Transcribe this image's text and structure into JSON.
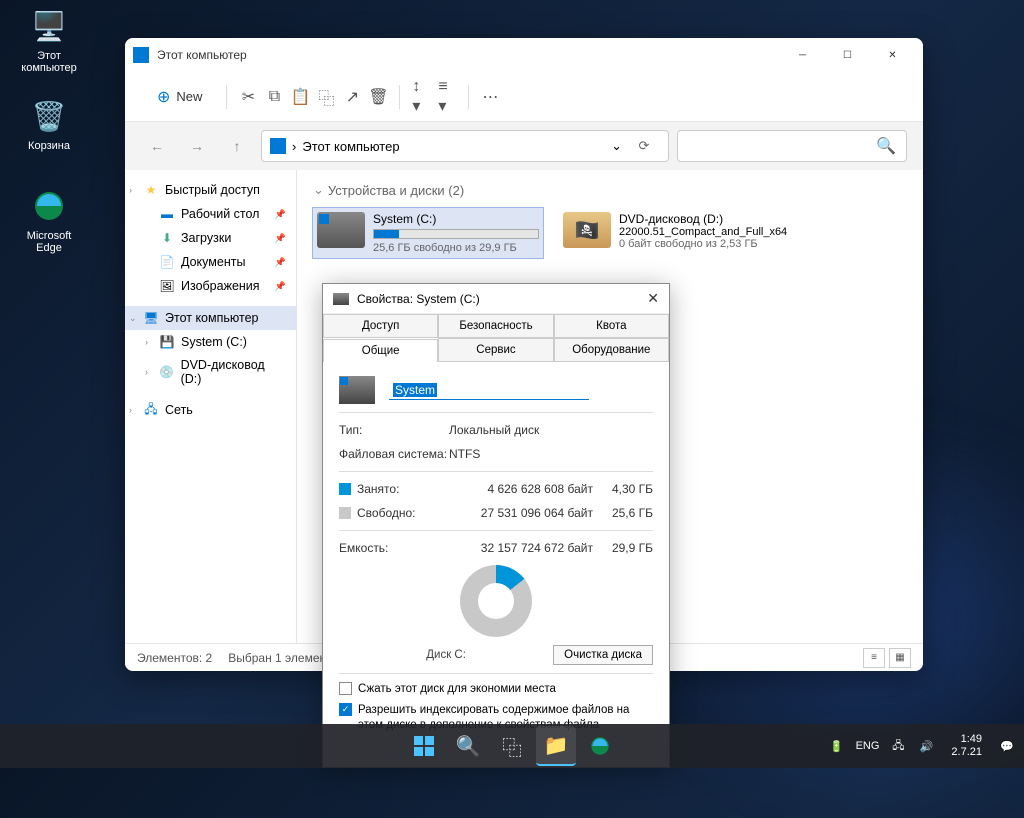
{
  "desktop": {
    "icons": [
      {
        "name": "Этот\nкомпьютер"
      },
      {
        "name": "Корзина"
      },
      {
        "name": "Microsoft\nEdge"
      }
    ]
  },
  "explorer": {
    "title": "Этот компьютер",
    "new_btn": "New",
    "breadcrumb": "Этот компьютер",
    "sidebar": {
      "quick": "Быстрый доступ",
      "desktop": "Рабочий стол",
      "downloads": "Загрузки",
      "documents": "Документы",
      "pictures": "Изображения",
      "this_pc": "Этот компьютер",
      "system": "System (C:)",
      "dvd": "DVD-дисковод (D:)",
      "network": "Сеть"
    },
    "section": "Устройства и диски (2)",
    "drives": {
      "c": {
        "name": "System (C:)",
        "free": "25,6 ГБ свободно из 29,9 ГБ",
        "fill_pct": 15
      },
      "d": {
        "name": "DVD-дисковод (D:)",
        "label": "22000.51_Compact_and_Full_x64",
        "free": "0 байт свободно из 2,53 ГБ"
      }
    },
    "status": {
      "count": "Элементов: 2",
      "selected": "Выбран 1 элемент"
    }
  },
  "props": {
    "title": "Свойства: System (C:)",
    "tabs_top": [
      "Доступ",
      "Безопасность",
      "Квота"
    ],
    "tabs_bottom": [
      "Общие",
      "Сервис",
      "Оборудование"
    ],
    "volume_name": "System",
    "type_label": "Тип:",
    "type_val": "Локальный диск",
    "fs_label": "Файловая система:",
    "fs_val": "NTFS",
    "used_label": "Занято:",
    "used_bytes": "4 626 628 608 байт",
    "used_gb": "4,30 ГБ",
    "free_label": "Свободно:",
    "free_bytes": "27 531 096 064 байт",
    "free_gb": "25,6 ГБ",
    "cap_label": "Емкость:",
    "cap_bytes": "32 157 724 672 байт",
    "cap_gb": "29,9 ГБ",
    "disk_label": "Диск C:",
    "cleanup": "Очистка диска",
    "compress": "Сжать этот диск для экономии места",
    "index": "Разрешить индексировать содержимое файлов на этом диске в дополнение к свойствам файла"
  },
  "taskbar": {
    "lang": "ENG",
    "time": "1:49",
    "date": "2.7.21"
  },
  "chart_data": {
    "type": "pie",
    "title": "Диск C:",
    "series": [
      {
        "name": "Занято",
        "value": 4626628608,
        "value_gb": 4.3,
        "color": "#0095d8"
      },
      {
        "name": "Свободно",
        "value": 27531096064,
        "value_gb": 25.6,
        "color": "#c8c8c8"
      }
    ],
    "total": {
      "bytes": 32157724672,
      "gb": 29.9
    }
  }
}
